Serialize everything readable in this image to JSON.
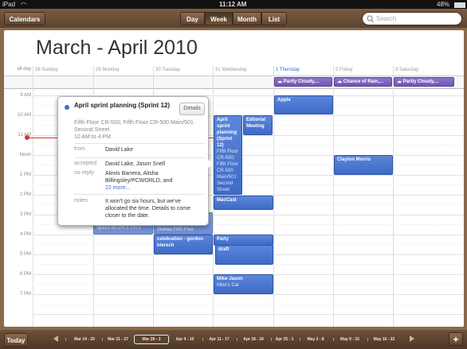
{
  "status": {
    "device": "iPad",
    "time": "11:12 AM",
    "battery": "48%"
  },
  "toolbar": {
    "calendars": "Calendars",
    "views": [
      "Day",
      "Week",
      "Month",
      "List"
    ],
    "active_view": "Week",
    "search_placeholder": "Search"
  },
  "title": "March - April 2010",
  "days": [
    {
      "num": "28",
      "name": "Sunday"
    },
    {
      "num": "29",
      "name": "Monday"
    },
    {
      "num": "30",
      "name": "Tuesday"
    },
    {
      "num": "31",
      "name": "Wednesday"
    },
    {
      "num": "1",
      "name": "Thursday"
    },
    {
      "num": "2",
      "name": "Friday"
    },
    {
      "num": "3",
      "name": "Saturday"
    }
  ],
  "allday_label": "all-day",
  "hours": [
    "9 AM",
    "10 AM",
    "11 AM",
    "Noon",
    "1 PM",
    "2 PM",
    "3 PM",
    "4 PM",
    "5 PM",
    "6 PM",
    "7 PM"
  ],
  "weather": [
    "Partly Cloudy,...",
    "Chance of Rain,...",
    "Partly Cloudy,..."
  ],
  "events": {
    "apple": "Apple",
    "april_sprint": {
      "title": "April sprint planning (Sprint 12)",
      "location": "Fifth Floor CR-500; Fifth Floor CR-500 Main/501 Second Street"
    },
    "editorial": "Editorial Meeting",
    "clayton": "Clayton Morris",
    "maccast": "MacCast",
    "specs": {
      "title": "Specs on CR-1",
      "sub": "CR-1"
    },
    "stories": {
      "title": "Stories",
      "sub": "Fifth Floo"
    },
    "celebration": "celebration - gordon biersch",
    "party": "Party",
    "draft": "draft",
    "mike": {
      "title": "Mike-Jason",
      "sub": "Mike's Car"
    }
  },
  "popover": {
    "title": "April sprint planning (Sprint 12)",
    "details_button": "Details",
    "location": "Fifth Floor CR-500; Fifth Floor CR-500 Main/501 Second Street",
    "time": "10 AM to 4 PM",
    "from_label": "from",
    "from_value": "David Lake",
    "accepted_label": "accepted",
    "accepted_value": "David Lake, Jason Snell",
    "noreply_label": "no reply",
    "noreply_value": "Alexis Barrera, Alisha Billingsley/PCWORLD, and",
    "more_link": "22 more...",
    "notes_label": "notes",
    "notes_value": "It won't go six hours, but we've allocated the time. Details to come closer to the date."
  },
  "bottom": {
    "today": "Today",
    "weeks": [
      "Mar 14 - 20",
      "Mar 21 - 27",
      "Mar 28 - 3",
      "Apr 4 - 10",
      "Apr 11 - 17",
      "Apr 18 - 24",
      "Apr 25 - 1",
      "May 2 - 8",
      "May 9 - 15",
      "May 16 - 22"
    ],
    "selected_week": "Mar 28 - 3",
    "add": "+"
  }
}
